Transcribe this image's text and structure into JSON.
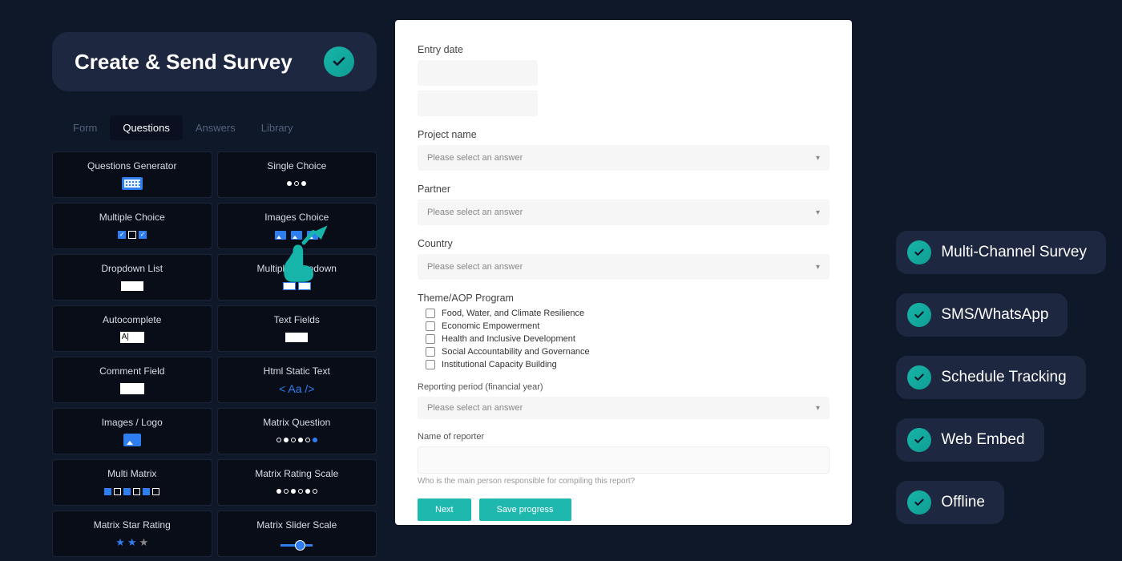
{
  "header": {
    "title": "Create & Send Survey"
  },
  "tabs": [
    "Form",
    "Questions",
    "Answers",
    "Library"
  ],
  "activeTab": 1,
  "questionTypes": [
    "Questions Generator",
    "Single Choice",
    "Multiple Choice",
    "Images Choice",
    "Dropdown List",
    "Multiple Dropdown",
    "Autocomplete",
    "Text Fields",
    "Comment Field",
    "Html Static Text",
    "Images / Logo",
    "Matrix Question",
    "Multi Matrix",
    "Matrix Rating Scale",
    "Matrix Star Rating",
    "Matrix Slider Scale"
  ],
  "htmlIconText": "< Aa />",
  "form": {
    "entryDateLabel": "Entry date",
    "projectNameLabel": "Project name",
    "partnerLabel": "Partner",
    "countryLabel": "Country",
    "selectPlaceholder": "Please select an answer",
    "themeLabel": "Theme/AOP Program",
    "themeOptions": [
      "Food, Water, and Climate Resilience",
      "Economic Empowerment",
      "Health and Inclusive Development",
      "Social Accountability and Governance",
      "Institutional Capacity Building"
    ],
    "reportingLabel": "Reporting period (financial year)",
    "reporterLabel": "Name of reporter",
    "reporterHelp": "Who is the main person responsible for compiling this report?",
    "nextBtn": "Next",
    "saveBtn": "Save progress"
  },
  "features": [
    "Multi-Channel Survey",
    "SMS/WhatsApp",
    "Schedule Tracking",
    "Web Embed",
    "Offline"
  ]
}
